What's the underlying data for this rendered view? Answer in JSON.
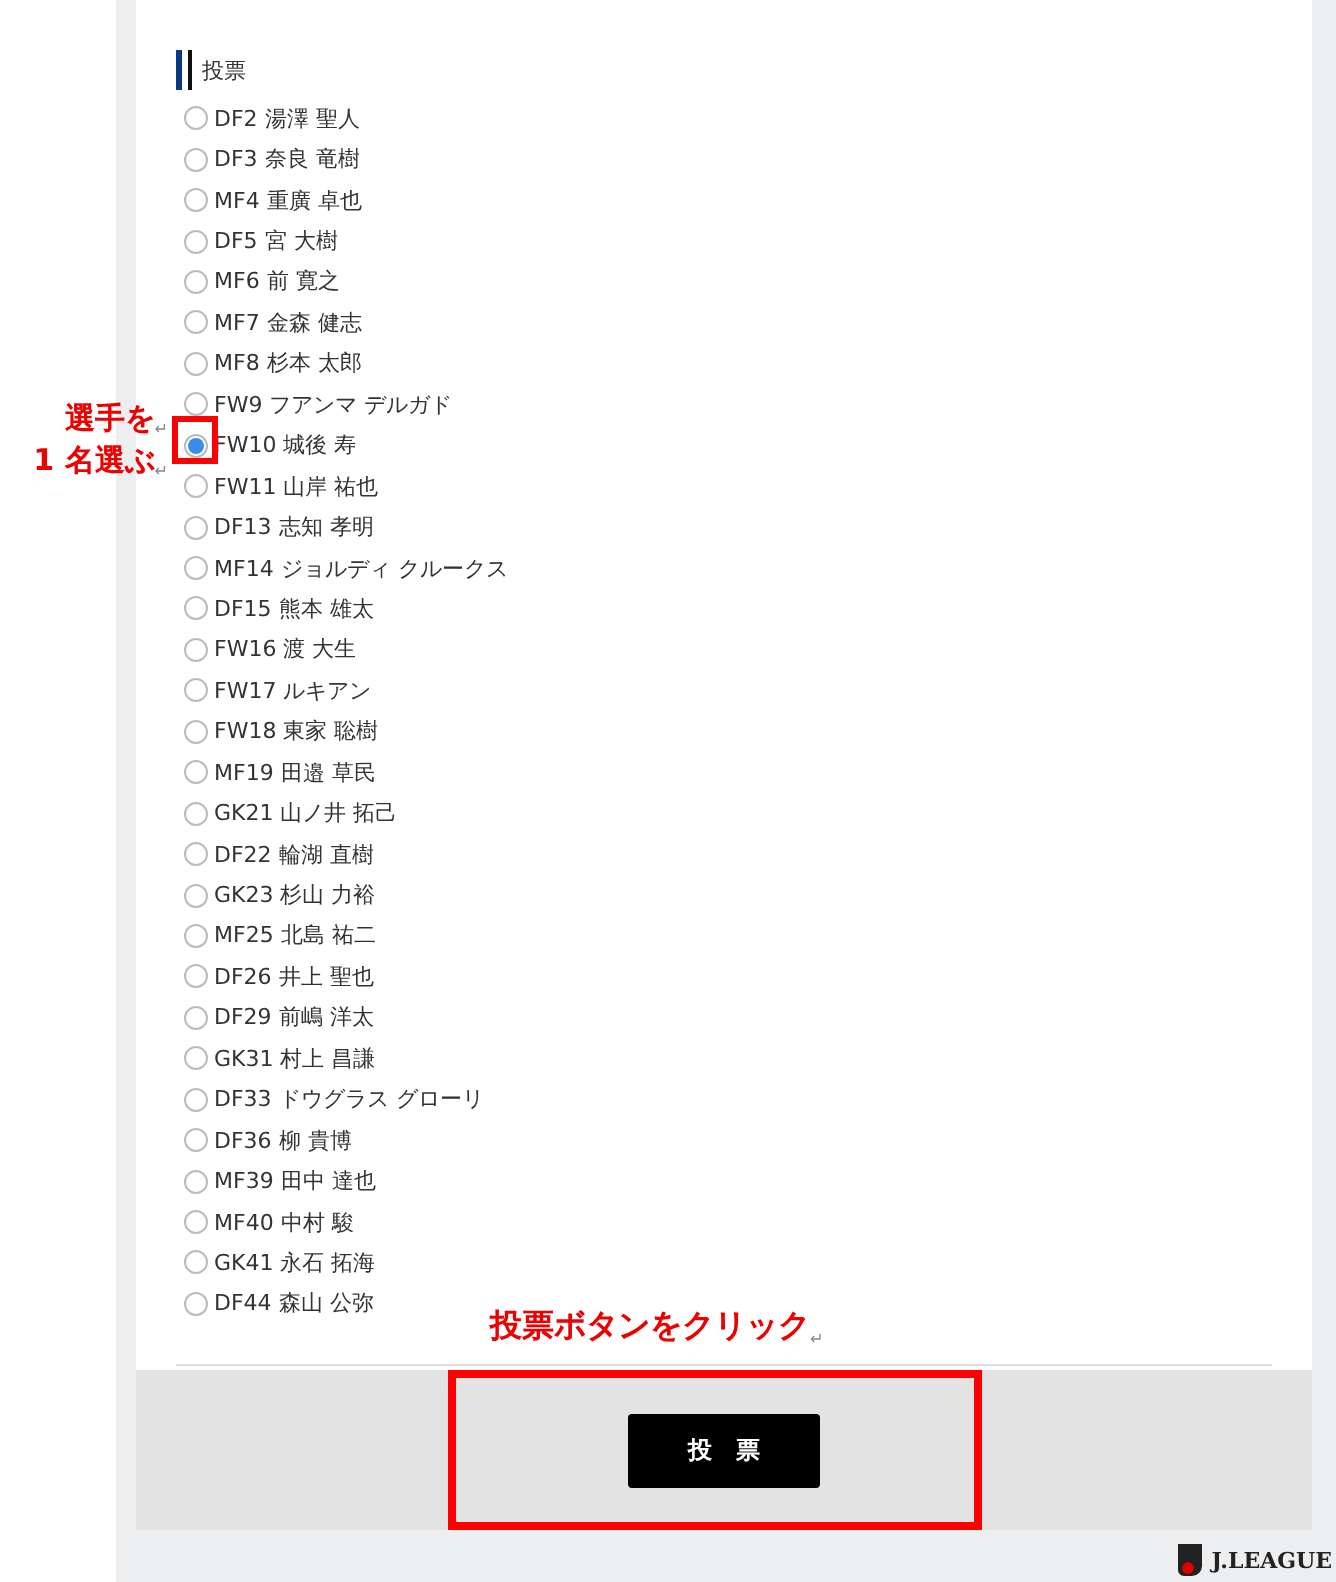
{
  "section_title": "投票",
  "players": [
    {
      "label": "DF2 湯澤 聖人",
      "selected": false
    },
    {
      "label": "DF3 奈良 竜樹",
      "selected": false
    },
    {
      "label": "MF4 重廣 卓也",
      "selected": false
    },
    {
      "label": "DF5 宮 大樹",
      "selected": false
    },
    {
      "label": "MF6 前 寛之",
      "selected": false
    },
    {
      "label": "MF7 金森 健志",
      "selected": false
    },
    {
      "label": "MF8 杉本 太郎",
      "selected": false
    },
    {
      "label": "FW9 フアンマ デルガド",
      "selected": false
    },
    {
      "label": "FW10 城後 寿",
      "selected": true
    },
    {
      "label": "FW11 山岸 祐也",
      "selected": false
    },
    {
      "label": "DF13 志知 孝明",
      "selected": false
    },
    {
      "label": "MF14 ジョルディ クルークス",
      "selected": false
    },
    {
      "label": "DF15 熊本 雄太",
      "selected": false
    },
    {
      "label": "FW16 渡 大生",
      "selected": false
    },
    {
      "label": "FW17 ルキアン",
      "selected": false
    },
    {
      "label": "FW18 東家 聡樹",
      "selected": false
    },
    {
      "label": "MF19 田邉 草民",
      "selected": false
    },
    {
      "label": "GK21 山ノ井 拓己",
      "selected": false
    },
    {
      "label": "DF22 輪湖 直樹",
      "selected": false
    },
    {
      "label": "GK23 杉山 力裕",
      "selected": false
    },
    {
      "label": "MF25 北島 祐二",
      "selected": false
    },
    {
      "label": "DF26 井上 聖也",
      "selected": false
    },
    {
      "label": "DF29 前嶋 洋太",
      "selected": false
    },
    {
      "label": "GK31 村上 昌謙",
      "selected": false
    },
    {
      "label": "DF33 ドウグラス グローリ",
      "selected": false
    },
    {
      "label": "DF36 柳 貴博",
      "selected": false
    },
    {
      "label": "MF39 田中 達也",
      "selected": false
    },
    {
      "label": "MF40 中村 駿",
      "selected": false
    },
    {
      "label": "GK41 永石 拓海",
      "selected": false
    },
    {
      "label": "DF44 森山 公弥",
      "selected": false
    }
  ],
  "vote_button": "投票",
  "logo": "J.LEAGUE",
  "annotations": {
    "select_hint": [
      {
        "text": "選手を",
        "mark": "↵"
      },
      {
        "text": "1 名選ぶ",
        "mark": "↵"
      }
    ],
    "click_hint": {
      "text": "投票ボタンをクリック",
      "mark": "↵"
    }
  }
}
